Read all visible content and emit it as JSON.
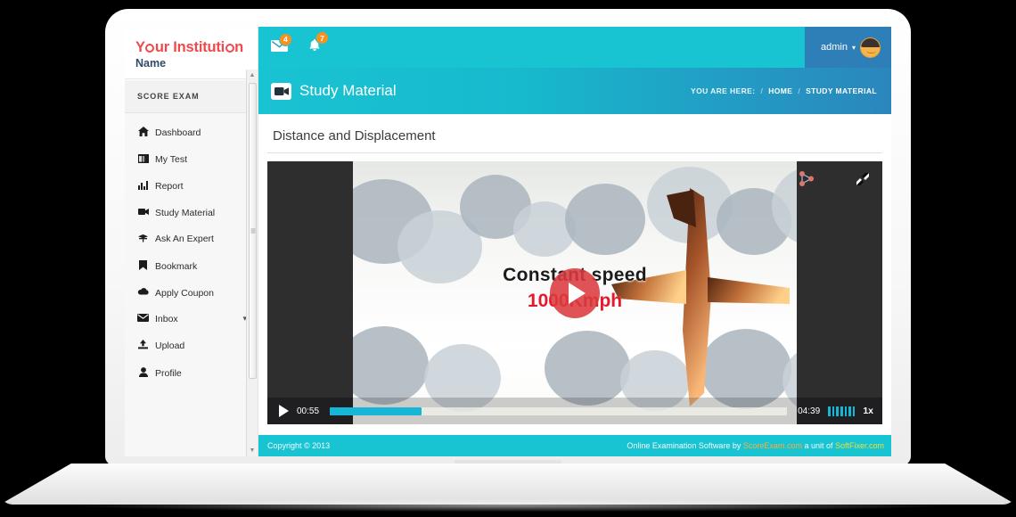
{
  "brand": {
    "line1_a": "Y",
    "line1_b": "ur Instituti",
    "line1_c": "n",
    "line2": "Name"
  },
  "sidebar": {
    "section_label": "SCORE EXAM",
    "items": [
      {
        "label": "Dashboard",
        "icon": "home-icon",
        "glyph": "⌂"
      },
      {
        "label": "My Test",
        "icon": "grid-icon",
        "glyph": "▤"
      },
      {
        "label": "Report",
        "icon": "bar-chart-icon",
        "glyph": "█"
      },
      {
        "label": "Study Material",
        "icon": "video-icon",
        "glyph": "■"
      },
      {
        "label": "Ask An Expert",
        "icon": "podium-icon",
        "glyph": "⚒"
      },
      {
        "label": "Bookmark",
        "icon": "bookmark-icon",
        "glyph": "⚑"
      },
      {
        "label": "Apply Coupon",
        "icon": "cloud-icon",
        "glyph": "☁"
      },
      {
        "label": "Inbox",
        "icon": "envelope-icon",
        "glyph": "✉",
        "caret": "▾"
      },
      {
        "label": "Upload",
        "icon": "upload-icon",
        "glyph": "↑"
      },
      {
        "label": "Profile",
        "icon": "user-icon",
        "glyph": "♟"
      }
    ]
  },
  "topbar": {
    "messages_icon": "envelope-icon",
    "messages_badge": "4",
    "alerts_icon": "bell-icon",
    "alerts_badge": "7",
    "admin_label": "admin",
    "admin_caret": "▾"
  },
  "pagehead": {
    "icon": "video-camera-icon",
    "title": "Study Material",
    "breadcrumb_label": "YOU ARE HERE:",
    "sep1": "/",
    "crumb_home": "HOME",
    "sep2": "/",
    "crumb_current": "STUDY MATERIAL"
  },
  "panel": {
    "title": "Distance and Displacement"
  },
  "video": {
    "caption_top": "Constant speed",
    "caption_bottom": "1000Kmph",
    "current_time": "00:55",
    "total_time": "04:39",
    "progress_percent": 20,
    "speed": "1x",
    "volume_bars": 7,
    "play_icon": "play-icon",
    "share_icon": "share-nodes-icon",
    "fullscreen_icon": "expand-icon"
  },
  "footer": {
    "copyright": "Copyright © 2013",
    "credit_prefix": "Online Examination Software by ",
    "credit_link1": "ScoreExam.com",
    "credit_mid": " a unit of ",
    "credit_link2": "SoftFixer.com"
  },
  "colors": {
    "cyan": "#18c3d2",
    "blue": "#2e7fb8",
    "orange_badge": "#f6921e",
    "red_brand": "#f0494b",
    "progress": "#17b5d6"
  }
}
